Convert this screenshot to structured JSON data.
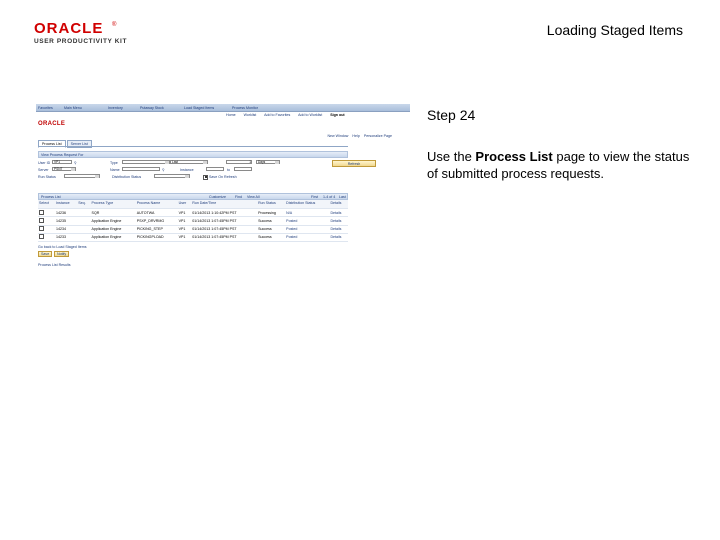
{
  "header": {
    "brand": "ORACLE",
    "brand_mark": "®",
    "brand_sub": "USER PRODUCTIVITY KIT",
    "title": "Loading Staged Items"
  },
  "step": {
    "number": "Step 24",
    "text_before": "Use the ",
    "text_bold": "Process List",
    "text_after": " page to view the status of submitted process requests."
  },
  "thumbnail": {
    "nav": [
      "Favorites",
      "Main Menu",
      "Inventory",
      "Putaway Stock",
      "Load Staged Items",
      "Process Monitor"
    ],
    "subnav": [
      "Home",
      "Worklist",
      "Add to Favorites",
      "Add to Worklist",
      "Sign out"
    ],
    "logo": "ORACLE",
    "toplinks": [
      "New Window",
      "Help",
      "Personalize Page"
    ],
    "tabs": [
      "Process List",
      "Server List"
    ],
    "section_title": "View Process Request For",
    "filters": {
      "user_id_label": "User ID",
      "user_id_value": "VP1",
      "type_label": "Type",
      "last_label": "Last",
      "last_value": "1",
      "last_unit": "Days",
      "server_label": "Server",
      "server_value": "PSNT",
      "name_label": "Name",
      "instance_label": "Instance",
      "to_label": "to",
      "run_status_label": "Run Status",
      "dist_status_label": "Distribution Status",
      "save_on_refresh_label": "Save On Refresh",
      "refresh_button": "Refresh"
    },
    "grid_title": "Process List",
    "grid_nav": [
      "Customize",
      "Find",
      "View All",
      "First",
      "1-4 of 4",
      "Last"
    ],
    "columns": [
      "Select",
      "Instance",
      "Seq.",
      "Process Type",
      "Process Name",
      "User",
      "Run Date/Time",
      "Run Status",
      "Distribution Status",
      "Details"
    ],
    "rows": [
      [
        "",
        "14236",
        "",
        "SQR",
        "AUTOTWA",
        "VP1",
        "01/14/2013 1:10:42PM PST",
        "Processing",
        "N/A",
        "Details"
      ],
      [
        "",
        "14235",
        "",
        "Application Engine",
        "PSXP_DRVRMG",
        "VP1",
        "01/14/2013 1:07:45PM PST",
        "Success",
        "Posted",
        "Details"
      ],
      [
        "",
        "14234",
        "",
        "Application Engine",
        "PICKING_STEP",
        "VP1",
        "01/14/2013 1:07:45PM PST",
        "Success",
        "Posted",
        "Details"
      ],
      [
        "",
        "14233",
        "",
        "Application Engine",
        "PICKINGPLOAD",
        "VP1",
        "01/14/2013 1:07:45PM PST",
        "Success",
        "Posted",
        "Details"
      ]
    ],
    "go_back_link": "Go back to Load Staged Items",
    "save_button": "Save",
    "notify_button": "Notify",
    "process_requests_link": "Process List Results"
  },
  "colors": {
    "brand_red": "#d00000",
    "link_blue": "#1d3b7a",
    "header_blue": "#c9d7ea"
  }
}
